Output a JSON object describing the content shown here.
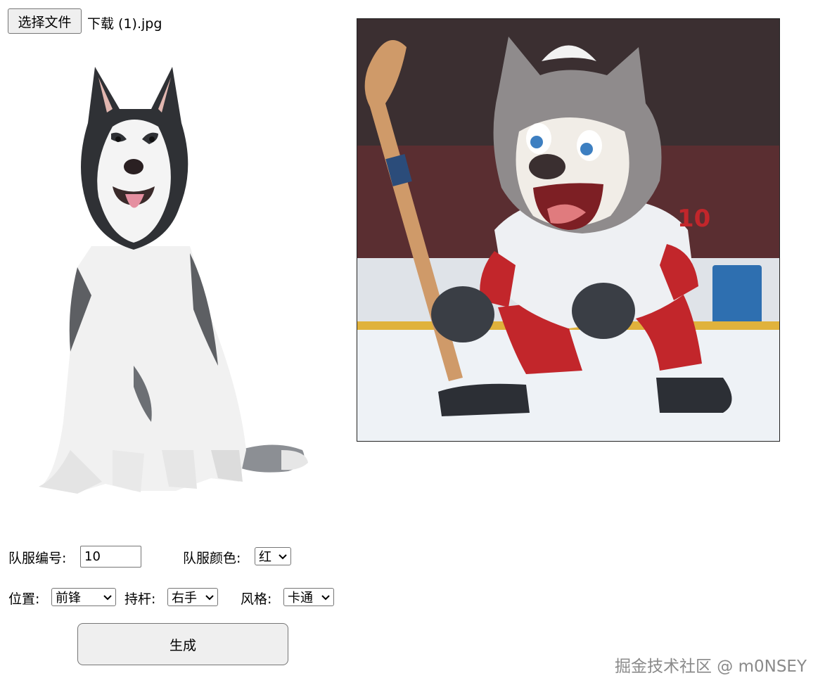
{
  "file_input": {
    "button_label": "选择文件",
    "file_name": "下载 (1).jpg"
  },
  "images": {
    "source": "husky-photo",
    "result": "hockey-wolf-mascot"
  },
  "mascot_jersey_number": "10",
  "form": {
    "number_label": "队服编号:",
    "number_value": "10",
    "color_label": "队服颜色:",
    "color_value": "红",
    "position_label": "位置:",
    "position_value": "前锋",
    "stick_label": "持杆:",
    "stick_value": "右手",
    "style_label": "风格:",
    "style_value": "卡通",
    "generate_label": "生成"
  },
  "watermark": "掘金技术社区 @ m0NSEY",
  "colors": {
    "jersey_red": "#c8282c",
    "button_bg": "#efefef"
  }
}
